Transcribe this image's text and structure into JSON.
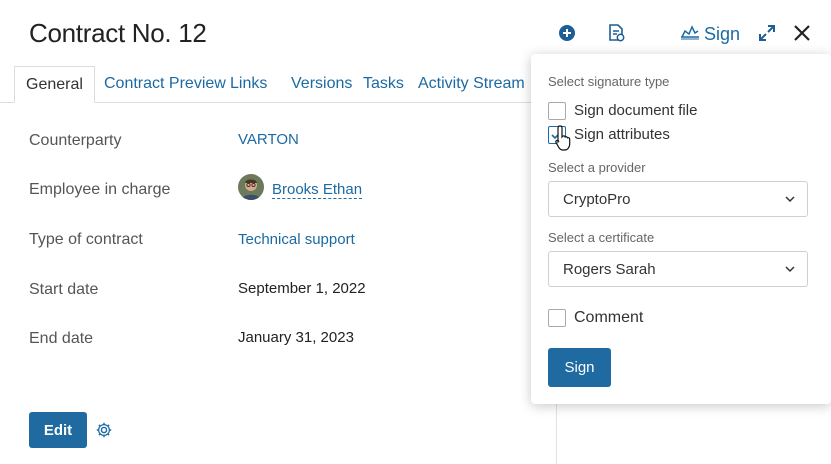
{
  "header": {
    "title": "Contract No. 12",
    "sign_label": "Sign",
    "icons": [
      "add-circle-icon",
      "document-settings-icon",
      "signature-icon",
      "expand-icon",
      "close-icon"
    ]
  },
  "tabs": [
    {
      "label": "General",
      "active": true
    },
    {
      "label": "Contract Preview",
      "active": false
    },
    {
      "label": "Links",
      "active": false
    },
    {
      "label": "Versions",
      "active": false
    },
    {
      "label": "Tasks",
      "active": false
    },
    {
      "label": "Activity Stream",
      "active": false
    }
  ],
  "fields": {
    "counterparty": {
      "label": "Counterparty",
      "value": "VARTON"
    },
    "employee": {
      "label": "Employee in charge",
      "value": "Brooks Ethan"
    },
    "type": {
      "label": "Type of contract",
      "value": "Technical support"
    },
    "start": {
      "label": "Start date",
      "value": "September 1, 2022"
    },
    "end": {
      "label": "End date",
      "value": "January 31, 2023"
    }
  },
  "footer": {
    "edit_label": "Edit"
  },
  "sign_popup": {
    "signature_type_label": "Select signature type",
    "option_document": {
      "label": "Sign document file",
      "checked": false
    },
    "option_attributes": {
      "label": "Sign attributes",
      "checked": true
    },
    "provider_label": "Select a provider",
    "provider_value": "CryptoPro",
    "certificate_label": "Select a certificate",
    "certificate_value": "Rogers Sarah",
    "comment": {
      "label": "Comment",
      "checked": false
    },
    "sign_button": "Sign"
  },
  "colors": {
    "accent": "#1f6aa0",
    "link": "#1c6aa3"
  }
}
